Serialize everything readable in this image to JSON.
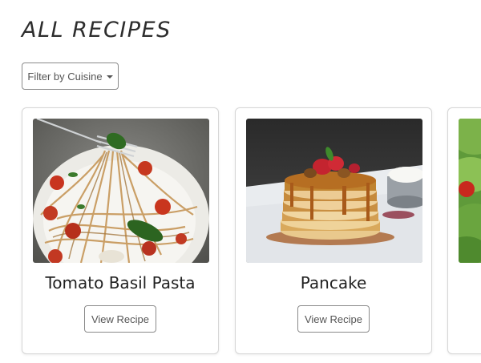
{
  "page": {
    "title": "ALL RECIPES"
  },
  "filter": {
    "label": "Filter by Cuisine",
    "icon": "caret-down-icon"
  },
  "recipes": [
    {
      "title": "Tomato Basil Pasta",
      "button_label": "View Recipe"
    },
    {
      "title": "Pancake",
      "button_label": "View Recipe"
    },
    {
      "title": "",
      "button_label": ""
    }
  ],
  "colors": {
    "border": "#d6d6d6",
    "button_border": "#8a8a8a",
    "button_text": "#555555",
    "title_text": "#222222"
  }
}
